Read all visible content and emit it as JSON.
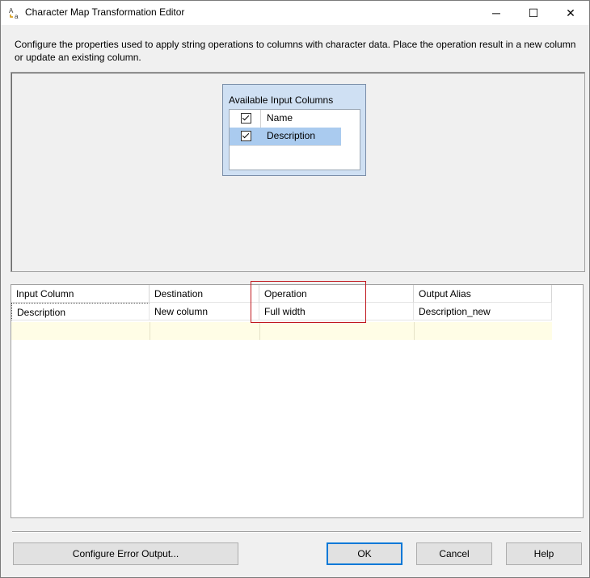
{
  "window": {
    "title": "Character Map Transformation Editor",
    "minimize_glyph": "─",
    "maximize_glyph": "☐",
    "close_glyph": "✕"
  },
  "description": "Configure the properties used to apply string operations to columns with character data. Place the operation result in a new column or update an existing column.",
  "available_inputs": {
    "title": "Available Input Columns",
    "columns": [
      {
        "name": "Name",
        "checked": true,
        "selected": false
      },
      {
        "name": "Description",
        "checked": true,
        "selected": true
      }
    ]
  },
  "grid": {
    "headers": [
      "Input Column",
      "Destination",
      "Operation",
      "Output Alias"
    ],
    "rows": [
      {
        "input_column": "Description",
        "destination": "New column",
        "operation": "Full width",
        "output_alias": "Description_new"
      }
    ]
  },
  "buttons": {
    "configure_error": "Configure Error Output...",
    "ok": "OK",
    "cancel": "Cancel",
    "help": "Help"
  },
  "colors": {
    "highlight": "#c0171e",
    "selection": "#aacbef",
    "new_row": "#fffde6"
  }
}
